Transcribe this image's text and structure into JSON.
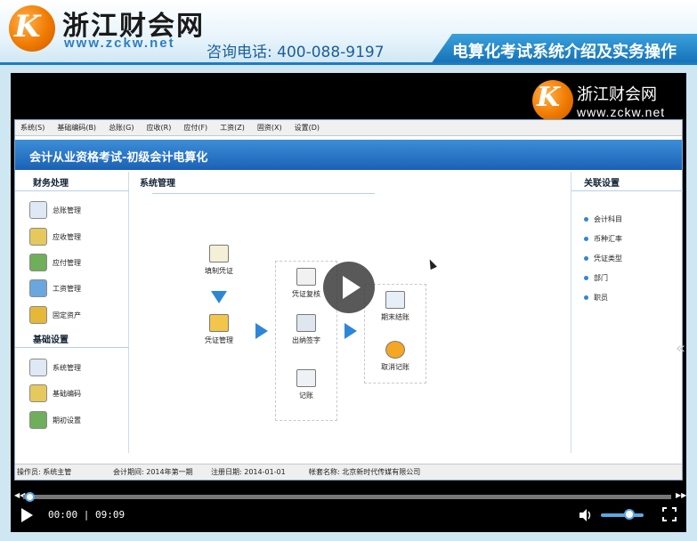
{
  "header": {
    "brand_name": "浙江财会网",
    "brand_url": "www.zckw.net",
    "phone_label": "咨询电话: 400-088-9197",
    "course_title": "电算化考试系统介绍及实务操作"
  },
  "video": {
    "watermark_name": "浙江财会网",
    "watermark_url": "www.zckw.net",
    "app": {
      "menu": [
        "系统(S)",
        "基础编码(B)",
        "总账(G)",
        "应收(R)",
        "应付(F)",
        "工资(Z)",
        "固资(X)",
        "设置(D)"
      ],
      "title": "会计从业资格考试-初级会计电算化",
      "left": {
        "section1": "财务处理",
        "items1": [
          "总账管理",
          "应收管理",
          "应付管理",
          "工资管理",
          "固定资产"
        ],
        "section2": "基础设置",
        "items2": [
          "系统管理",
          "基础编码",
          "期初设置"
        ]
      },
      "main": {
        "heading": "系统管理",
        "flow": {
          "make_voucher": "填制凭证",
          "manage_voucher": "凭证管理",
          "review": "凭证复核",
          "cashier_sign": "出纳签字",
          "post": "记账",
          "period_close": "期末结账",
          "cancel_post": "取消记账"
        }
      },
      "right": {
        "heading": "关联设置",
        "links": [
          "会计科目",
          "币种汇率",
          "凭证类型",
          "部门",
          "职员"
        ]
      },
      "status": {
        "operator": "操作员: 系统主管",
        "period": "会计期间: 2014年第一期",
        "reg_date": "注册日期: 2014-01-01",
        "account": "帐套名称: 北京新时代传媒有限公司"
      }
    },
    "controls": {
      "time": "00:00 | 09:09",
      "progress": 0.0,
      "volume": 0.65
    }
  },
  "colors": {
    "accent": "#1c7cc2",
    "app_title_bar": "#1b61b5",
    "logo_orange": "#f07a00"
  }
}
